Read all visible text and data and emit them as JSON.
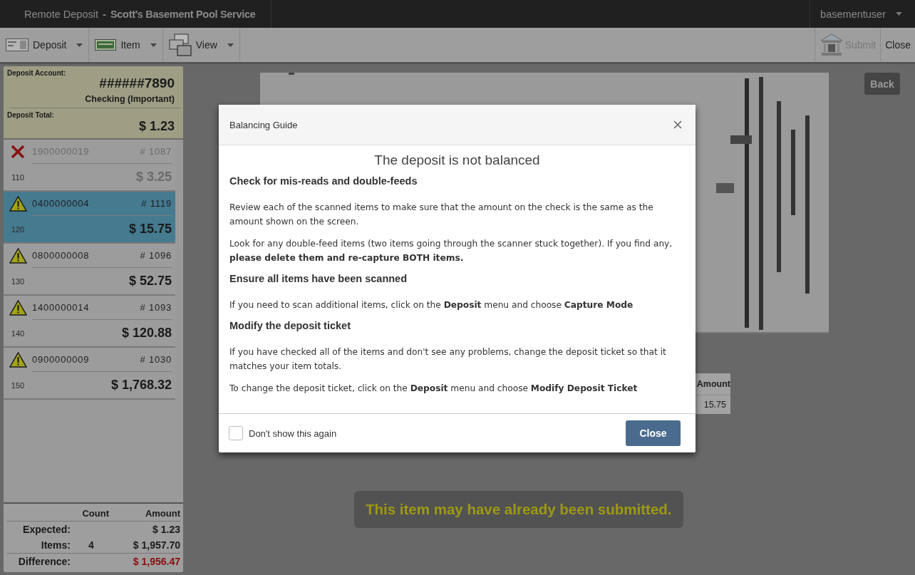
{
  "header": {
    "app": "Remote Deposit",
    "separator": "-",
    "company": "Scott's Basement Pool Service",
    "user": "basementuser"
  },
  "toolbar": {
    "menus": [
      {
        "label": "Deposit",
        "kind": "slip"
      },
      {
        "label": "Item",
        "kind": "check"
      },
      {
        "label": "View",
        "kind": "windows"
      }
    ],
    "submit": {
      "label": "Submit",
      "disabled": true
    },
    "close": "Close"
  },
  "account": {
    "label": "Deposit Account:",
    "number": "######7890",
    "type": "Checking (Important)",
    "total_label": "Deposit Total:",
    "total": "$ 1.23"
  },
  "items": [
    {
      "kind": "error",
      "routing": "1900000019",
      "check": "# 1087",
      "sequence": "110",
      "amount": "$ 3.25",
      "selected": false
    },
    {
      "kind": "warning",
      "routing": "0400000004",
      "check": "# 1119",
      "sequence": "120",
      "amount": "$ 15.75",
      "selected": true
    },
    {
      "kind": "warning",
      "routing": "0800000008",
      "check": "# 1096",
      "sequence": "130",
      "amount": "$ 52.75",
      "selected": false
    },
    {
      "kind": "warning",
      "routing": "1400000014",
      "check": "# 1093",
      "sequence": "140",
      "amount": "$ 120.88",
      "selected": false
    },
    {
      "kind": "warning",
      "routing": "0900000009",
      "check": "# 1030",
      "sequence": "150",
      "amount": "$ 1,768.32",
      "selected": false
    }
  ],
  "totals": {
    "columns": [
      "Count",
      "Amount"
    ],
    "rows": [
      {
        "label": "Expected:",
        "count": "",
        "amount": "$ 1.23",
        "kind": "normal"
      },
      {
        "label": "Items:",
        "count": "4",
        "amount": "$ 1,957.70",
        "kind": "normal"
      },
      {
        "label": "Difference:",
        "count": "",
        "amount": "$ 1,956.47",
        "kind": "difference"
      }
    ]
  },
  "viewer": {
    "back": "Back",
    "table": {
      "column": "Amount",
      "value": "15.75"
    },
    "notice": "This item may have already been submitted."
  },
  "dialog": {
    "title": "Balancing Guide",
    "heading": "The deposit is not balanced",
    "sections": [
      {
        "title": "Check for mis-reads and double-feeds",
        "paragraphs": [
          "Review each of the scanned items to make sure that the amount on the check is the same as the amount shown on the screen.",
          "Look for any double-feed items (two items going through the scanner stuck together). If you find any, **please delete them and re-capture BOTH items.**"
        ]
      },
      {
        "title": "Ensure all items have been scanned",
        "paragraphs": [
          "If you need to scan additional items, click on the **Deposit** menu and choose **Capture Mode**"
        ]
      },
      {
        "title": "Modify the deposit ticket",
        "paragraphs": [
          "If you have checked all of the items and don't see any problems, change the deposit ticket so that it matches your item totals.",
          "To change the deposit ticket, click on the **Deposit** menu and choose **Modify Deposit Ticket**"
        ]
      }
    ],
    "checkbox": {
      "label": "Don't show this again",
      "checked": false
    },
    "button": "Close"
  }
}
